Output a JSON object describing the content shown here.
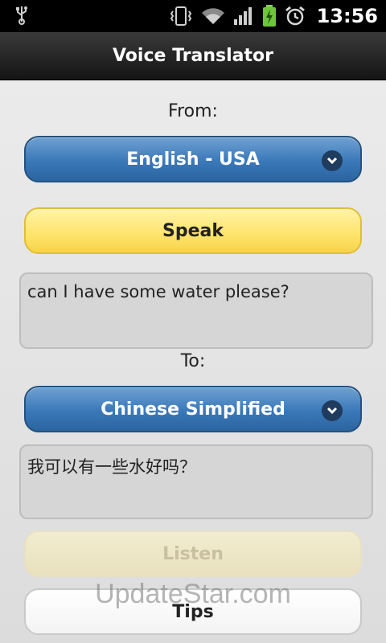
{
  "status_bar": {
    "time": "13:56",
    "icons": [
      "usb-icon",
      "vibrate-icon",
      "wifi-icon",
      "signal-icon",
      "battery-charging-icon",
      "alarm-icon"
    ]
  },
  "app": {
    "title": "Voice Translator"
  },
  "from": {
    "label": "From:",
    "language": "English - USA",
    "speak_label": "Speak",
    "text": "can I have some water please?"
  },
  "to": {
    "label": "To:",
    "language": "Chinese Simplified",
    "text": "我可以有一些水好吗？"
  },
  "actions": {
    "listen_label": "Listen",
    "tips_label": "Tips"
  },
  "watermark": "UpdateStar.com",
  "colors": {
    "accent_blue": "#3a78b9",
    "speak_yellow": "#ffe36a",
    "titlebar": "#1a1a1a"
  }
}
